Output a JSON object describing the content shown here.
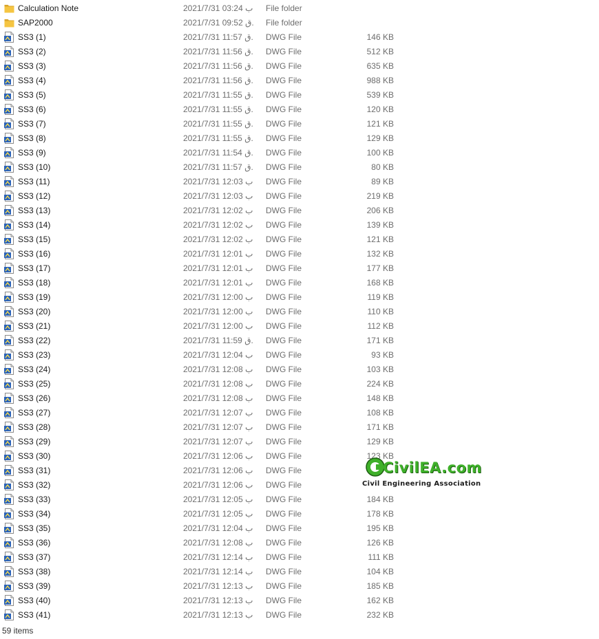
{
  "items": [
    {
      "name": "Calculation Note",
      "date": "2021/7/31 03:24 ب",
      "type": "File folder",
      "size": "",
      "icon": "folder-icon"
    },
    {
      "name": "SAP2000",
      "date": "2021/7/31 09:52 ق.",
      "type": "File folder",
      "size": "",
      "icon": "folder-icon"
    },
    {
      "name": "SS3 (1)",
      "date": "2021/7/31 11:57 ق.",
      "type": "DWG File",
      "size": "146 KB",
      "icon": "dwg-file-icon"
    },
    {
      "name": "SS3 (2)",
      "date": "2021/7/31 11:56 ق.",
      "type": "DWG File",
      "size": "512 KB",
      "icon": "dwg-file-icon"
    },
    {
      "name": "SS3 (3)",
      "date": "2021/7/31 11:56 ق.",
      "type": "DWG File",
      "size": "635 KB",
      "icon": "dwg-file-icon"
    },
    {
      "name": "SS3 (4)",
      "date": "2021/7/31 11:56 ق.",
      "type": "DWG File",
      "size": "988 KB",
      "icon": "dwg-file-icon"
    },
    {
      "name": "SS3 (5)",
      "date": "2021/7/31 11:55 ق.",
      "type": "DWG File",
      "size": "539 KB",
      "icon": "dwg-file-icon"
    },
    {
      "name": "SS3 (6)",
      "date": "2021/7/31 11:55 ق.",
      "type": "DWG File",
      "size": "120 KB",
      "icon": "dwg-file-icon"
    },
    {
      "name": "SS3 (7)",
      "date": "2021/7/31 11:55 ق.",
      "type": "DWG File",
      "size": "121 KB",
      "icon": "dwg-file-icon"
    },
    {
      "name": "SS3 (8)",
      "date": "2021/7/31 11:55 ق.",
      "type": "DWG File",
      "size": "129 KB",
      "icon": "dwg-file-icon"
    },
    {
      "name": "SS3 (9)",
      "date": "2021/7/31 11:54 ق.",
      "type": "DWG File",
      "size": "100 KB",
      "icon": "dwg-file-icon"
    },
    {
      "name": "SS3 (10)",
      "date": "2021/7/31 11:57 ق.",
      "type": "DWG File",
      "size": "80 KB",
      "icon": "dwg-file-icon"
    },
    {
      "name": "SS3 (11)",
      "date": "2021/7/31 12:03 ب",
      "type": "DWG File",
      "size": "89 KB",
      "icon": "dwg-file-icon"
    },
    {
      "name": "SS3 (12)",
      "date": "2021/7/31 12:03 ب",
      "type": "DWG File",
      "size": "219 KB",
      "icon": "dwg-file-icon"
    },
    {
      "name": "SS3 (13)",
      "date": "2021/7/31 12:02 ب",
      "type": "DWG File",
      "size": "206 KB",
      "icon": "dwg-file-icon"
    },
    {
      "name": "SS3 (14)",
      "date": "2021/7/31 12:02 ب",
      "type": "DWG File",
      "size": "139 KB",
      "icon": "dwg-file-icon"
    },
    {
      "name": "SS3 (15)",
      "date": "2021/7/31 12:02 ب",
      "type": "DWG File",
      "size": "121 KB",
      "icon": "dwg-file-icon"
    },
    {
      "name": "SS3 (16)",
      "date": "2021/7/31 12:01 ب",
      "type": "DWG File",
      "size": "132 KB",
      "icon": "dwg-file-icon"
    },
    {
      "name": "SS3 (17)",
      "date": "2021/7/31 12:01 ب",
      "type": "DWG File",
      "size": "177 KB",
      "icon": "dwg-file-icon"
    },
    {
      "name": "SS3 (18)",
      "date": "2021/7/31 12:01 ب",
      "type": "DWG File",
      "size": "168 KB",
      "icon": "dwg-file-icon"
    },
    {
      "name": "SS3 (19)",
      "date": "2021/7/31 12:00 ب",
      "type": "DWG File",
      "size": "119 KB",
      "icon": "dwg-file-icon"
    },
    {
      "name": "SS3 (20)",
      "date": "2021/7/31 12:00 ب",
      "type": "DWG File",
      "size": "110 KB",
      "icon": "dwg-file-icon"
    },
    {
      "name": "SS3 (21)",
      "date": "2021/7/31 12:00 ب",
      "type": "DWG File",
      "size": "112 KB",
      "icon": "dwg-file-icon"
    },
    {
      "name": "SS3 (22)",
      "date": "2021/7/31 11:59 ق.",
      "type": "DWG File",
      "size": "171 KB",
      "icon": "dwg-file-icon"
    },
    {
      "name": "SS3 (23)",
      "date": "2021/7/31 12:04 ب",
      "type": "DWG File",
      "size": "93 KB",
      "icon": "dwg-file-icon"
    },
    {
      "name": "SS3 (24)",
      "date": "2021/7/31 12:08 ب",
      "type": "DWG File",
      "size": "103 KB",
      "icon": "dwg-file-icon"
    },
    {
      "name": "SS3 (25)",
      "date": "2021/7/31 12:08 ب",
      "type": "DWG File",
      "size": "224 KB",
      "icon": "dwg-file-icon"
    },
    {
      "name": "SS3 (26)",
      "date": "2021/7/31 12:08 ب",
      "type": "DWG File",
      "size": "148 KB",
      "icon": "dwg-file-icon"
    },
    {
      "name": "SS3 (27)",
      "date": "2021/7/31 12:07 ب",
      "type": "DWG File",
      "size": "108 KB",
      "icon": "dwg-file-icon"
    },
    {
      "name": "SS3 (28)",
      "date": "2021/7/31 12:07 ب",
      "type": "DWG File",
      "size": "171 KB",
      "icon": "dwg-file-icon"
    },
    {
      "name": "SS3 (29)",
      "date": "2021/7/31 12:07 ب",
      "type": "DWG File",
      "size": "129 KB",
      "icon": "dwg-file-icon"
    },
    {
      "name": "SS3 (30)",
      "date": "2021/7/31 12:06 ب",
      "type": "DWG File",
      "size": "123 KB",
      "icon": "dwg-file-icon"
    },
    {
      "name": "SS3 (31)",
      "date": "2021/7/31 12:06 ب",
      "type": "DWG File",
      "size": "",
      "icon": "dwg-file-icon"
    },
    {
      "name": "SS3 (32)",
      "date": "2021/7/31 12:06 ب",
      "type": "DWG File",
      "size": "",
      "icon": "dwg-file-icon"
    },
    {
      "name": "SS3 (33)",
      "date": "2021/7/31 12:05 ب",
      "type": "DWG File",
      "size": "184 KB",
      "icon": "dwg-file-icon"
    },
    {
      "name": "SS3 (34)",
      "date": "2021/7/31 12:05 ب",
      "type": "DWG File",
      "size": "178 KB",
      "icon": "dwg-file-icon"
    },
    {
      "name": "SS3 (35)",
      "date": "2021/7/31 12:04 ب",
      "type": "DWG File",
      "size": "195 KB",
      "icon": "dwg-file-icon"
    },
    {
      "name": "SS3 (36)",
      "date": "2021/7/31 12:08 ب",
      "type": "DWG File",
      "size": "126 KB",
      "icon": "dwg-file-icon"
    },
    {
      "name": "SS3 (37)",
      "date": "2021/7/31 12:14 ب",
      "type": "DWG File",
      "size": "111 KB",
      "icon": "dwg-file-icon"
    },
    {
      "name": "SS3 (38)",
      "date": "2021/7/31 12:14 ب",
      "type": "DWG File",
      "size": "104 KB",
      "icon": "dwg-file-icon"
    },
    {
      "name": "SS3 (39)",
      "date": "2021/7/31 12:13 ب",
      "type": "DWG File",
      "size": "185 KB",
      "icon": "dwg-file-icon"
    },
    {
      "name": "SS3 (40)",
      "date": "2021/7/31 12:13 ب",
      "type": "DWG File",
      "size": "162 KB",
      "icon": "dwg-file-icon"
    },
    {
      "name": "SS3 (41)",
      "date": "2021/7/31 12:13 ب",
      "type": "DWG File",
      "size": "232 KB",
      "icon": "dwg-file-icon"
    }
  ],
  "status": {
    "item_count": "59 items"
  },
  "watermark": {
    "brand": "CivilEA.com",
    "subtitle": "Civil Engineering Association"
  },
  "colors": {
    "folder": "#f5c542",
    "folder_dark": "#d9a42a",
    "dwg_blue": "#2a62b8",
    "watermark_green": "#3fb02a"
  }
}
